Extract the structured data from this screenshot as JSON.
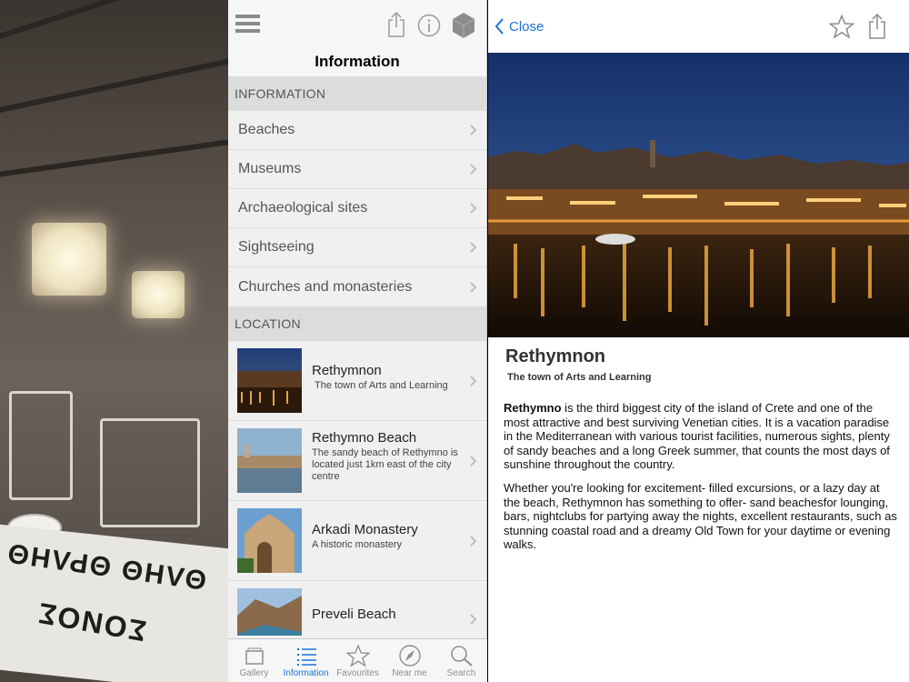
{
  "middle": {
    "title": "Information",
    "sections": [
      {
        "header": "INFORMATION",
        "rows": [
          {
            "label": "Beaches"
          },
          {
            "label": "Museums"
          },
          {
            "label": "Archaeological sites"
          },
          {
            "label": "Sightseeing"
          },
          {
            "label": "Churches and monasteries"
          }
        ]
      },
      {
        "header": "LOCATION",
        "items": [
          {
            "title": "Rethymnon",
            "subtitle": "The town of Arts and Learning"
          },
          {
            "title": "Rethymno Beach",
            "subtitle": "The sandy beach of Rethymno is located just 1km east of the city centre"
          },
          {
            "title": "Arkadi Monastery",
            "subtitle": "A historic monastery"
          },
          {
            "title": "Preveli Beach",
            "subtitle": ""
          }
        ]
      }
    ],
    "toolbar_icons": [
      "menu-icon",
      "share-icon",
      "info-icon",
      "cube-icon"
    ]
  },
  "tabbar": {
    "tabs": [
      {
        "label": "Gallery",
        "icon": "gallery-icon",
        "active": false
      },
      {
        "label": "Information",
        "icon": "list-icon",
        "active": true
      },
      {
        "label": "Favourites",
        "icon": "star-icon",
        "active": false
      },
      {
        "label": "Near me",
        "icon": "compass-icon",
        "active": false
      },
      {
        "label": "Search",
        "icon": "search-icon",
        "active": false
      }
    ]
  },
  "detail": {
    "close_label": "Close",
    "title": "Rethymnon",
    "subtitle": "The town of Arts and Learning",
    "para1_bold": "Rethymno",
    "para1_rest": " is the third biggest city of the island of Crete and one of the most attractive and best surviving Venetian cities. It is a vacation paradise in the Mediterranean with various tourist facilities, numerous sights, plenty of sandy beaches and a long Greek summer,  that counts the most days of sunshine throughout the country.",
    "para2": "Whether you're looking for excitement- filled excursions, or a lazy day at the beach, Rethymnon has something to offer- sand beachesfor lounging, bars, nightclubs for partying away the nights, excellent restaurants, such as stunning coastal road and a dreamy Old Town for your daytime or evening walks."
  },
  "background": {
    "newspaper_text_1": "ΘΛΗΘ ΘΡΛΗΘ",
    "newspaper_text_2": "ΣΟΝΟΣ"
  },
  "colors": {
    "accent": "#1a73d8",
    "section_header_bg": "#dcdcdc",
    "list_bg": "#f0f0f0"
  }
}
